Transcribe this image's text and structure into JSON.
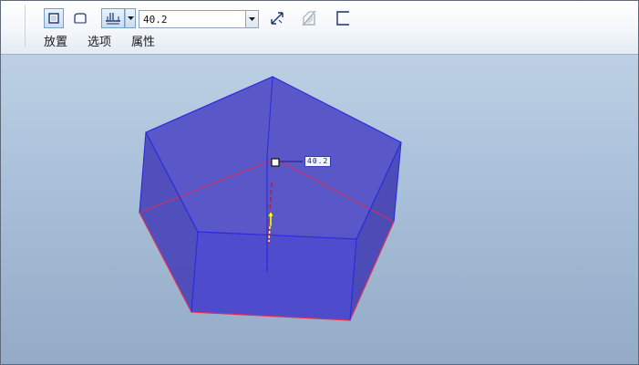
{
  "toolbar": {
    "depth_value": "40.2",
    "tabs": {
      "placement": "放置",
      "options": "选项",
      "properties": "属性"
    },
    "icons": {
      "solid": "solid-extrude-icon",
      "surface": "surface-extrude-icon",
      "depth_blind": "blind-depth-icon",
      "dropdown": "chevron-down-icon",
      "flip": "flip-direction-icon",
      "remove_material": "remove-material-icon",
      "thicken": "thicken-sketch-icon"
    }
  },
  "viewport": {
    "dimension_label": "40.2",
    "colors": {
      "solid_fill": "#4b45c9",
      "edge_blue": "#2a2ae0",
      "edge_red": "#e0305a",
      "drag_handle": "#ffff40"
    }
  }
}
